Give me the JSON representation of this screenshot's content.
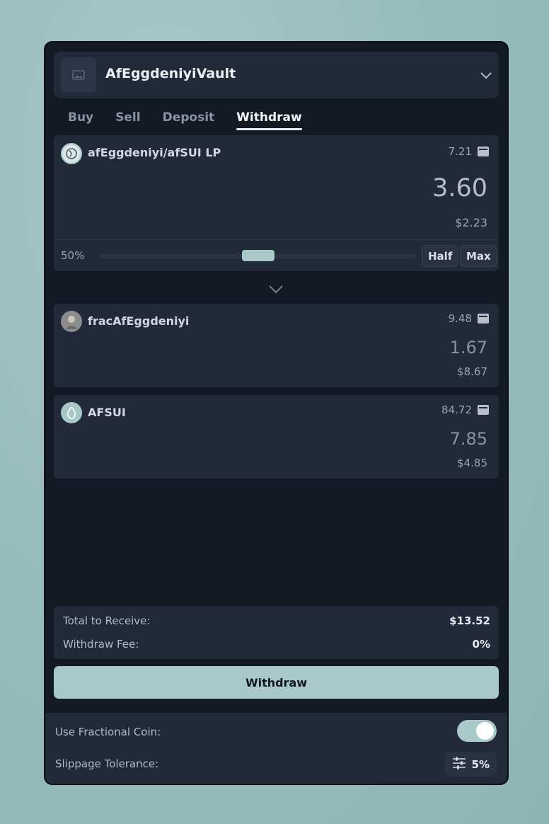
{
  "header": {
    "vault_name": "AfEggdeniyiVault"
  },
  "tabs": [
    {
      "label": "Buy",
      "active": false
    },
    {
      "label": "Sell",
      "active": false
    },
    {
      "label": "Deposit",
      "active": false
    },
    {
      "label": "Withdraw",
      "active": true
    }
  ],
  "input_token": {
    "name": "afEggdeniyi/afSUI LP",
    "balance": "7.21",
    "amount": "3.60",
    "usd": "$2.23",
    "percent_label": "50%",
    "percent_value": 0.5,
    "half_label": "Half",
    "max_label": "Max"
  },
  "outputs": [
    {
      "name": "fracAfEggdeniyi",
      "balance": "9.48",
      "amount": "1.67",
      "usd": "$8.67"
    },
    {
      "name": "AFSUI",
      "balance": "84.72",
      "amount": "7.85",
      "usd": "$4.85"
    }
  ],
  "summary": {
    "total_label": "Total to Receive:",
    "total_value": "$13.52",
    "fee_label": "Withdraw Fee:",
    "fee_value": "0%"
  },
  "action": {
    "label": "Withdraw"
  },
  "settings": {
    "fractional_label": "Use Fractional Coin:",
    "fractional_enabled": true,
    "slippage_label": "Slippage Tolerance:",
    "slippage_value": "5%"
  },
  "colors": {
    "accent": "#a9c9c8",
    "panel": "#141a24",
    "card": "#222a39"
  }
}
